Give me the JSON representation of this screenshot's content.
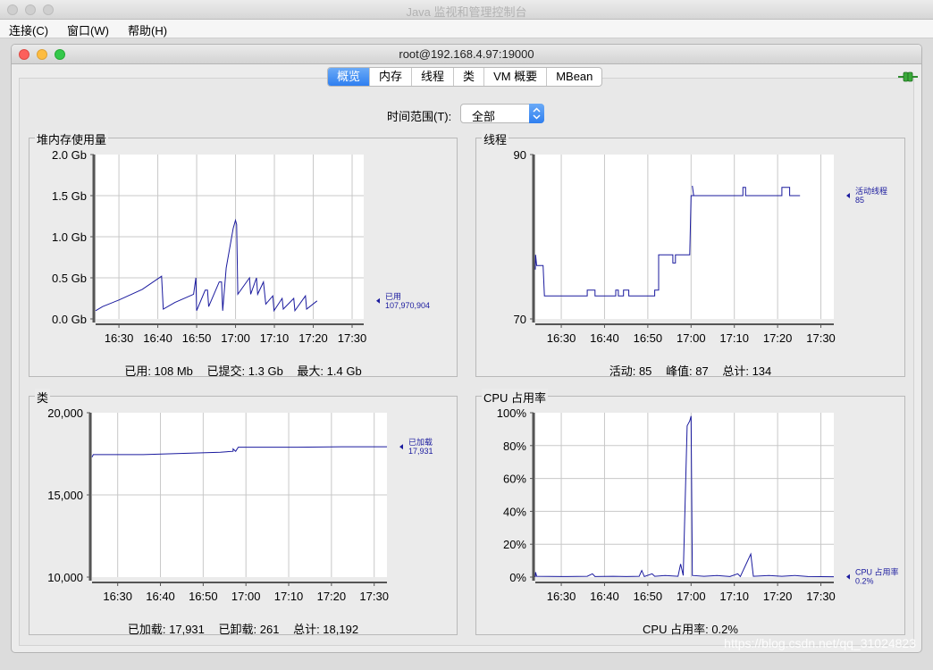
{
  "app": {
    "title": "Java 监视和管理控制台"
  },
  "menu": {
    "items": [
      "连接(C)",
      "窗口(W)",
      "帮助(H)"
    ]
  },
  "window": {
    "title": "root@192.168.4.97:19000"
  },
  "tabs": [
    "概览",
    "内存",
    "线程",
    "类",
    "VM 概要",
    "MBean"
  ],
  "time_range": {
    "label": "时间范围(T):",
    "value": "全部"
  },
  "panels": {
    "heap": {
      "title": "堆内存使用量",
      "footer": [
        "已用: 108 Mb",
        "已提交: 1.3 Gb",
        "最大: 1.4 Gb"
      ]
    },
    "threads": {
      "title": "线程",
      "footer": [
        "活动: 85",
        "峰值: 87",
        "总计: 134"
      ]
    },
    "classes": {
      "title": "类",
      "footer": [
        "已加载: 17,931",
        "已卸载: 261",
        "总计: 18,192"
      ]
    },
    "cpu": {
      "title": "CPU 占用率",
      "footer": [
        "CPU 占用率: 0.2%"
      ]
    }
  },
  "colors": {
    "line": "#1a1a9e",
    "grid": "#c8c8c8",
    "accent": "#2f7ff0"
  },
  "icons": {
    "connection": "connection-plug-icon"
  },
  "watermark": "https://blog.csdn.net/qq_31024823",
  "chart_data": [
    {
      "id": "heap",
      "type": "line",
      "x_ticks": [
        "16:30",
        "16:40",
        "16:50",
        "17:00",
        "17:10",
        "17:20",
        "17:30"
      ],
      "y_ticks": [
        "0.0 Gb",
        "0.5 Gb",
        "1.0 Gb",
        "1.5 Gb",
        "2.0 Gb"
      ],
      "ylim": [
        0,
        2.0
      ],
      "xlim": [
        16.4,
        17.55
      ],
      "tick_start": 16.5,
      "tick_step": 0.1667,
      "legend": [
        "已用",
        "107,970,904"
      ],
      "series": [
        {
          "name": "已用",
          "points": [
            [
              16.4,
              0.1
            ],
            [
              16.43,
              0.15
            ],
            [
              16.5,
              0.23
            ],
            [
              16.6,
              0.36
            ],
            [
              16.683,
              0.52
            ],
            [
              16.69,
              0.12
            ],
            [
              16.74,
              0.2
            ],
            [
              16.82,
              0.3
            ],
            [
              16.83,
              0.5
            ],
            [
              16.833,
              0.1
            ],
            [
              16.87,
              0.35
            ],
            [
              16.88,
              0.35
            ],
            [
              16.885,
              0.15
            ],
            [
              16.93,
              0.45
            ],
            [
              16.94,
              0.45
            ],
            [
              16.945,
              0.1
            ],
            [
              16.96,
              0.62
            ],
            [
              16.99,
              1.1
            ],
            [
              17.0,
              1.2
            ],
            [
              17.005,
              1.15
            ],
            [
              17.01,
              0.3
            ],
            [
              17.06,
              0.5
            ],
            [
              17.065,
              0.3
            ],
            [
              17.09,
              0.5
            ],
            [
              17.095,
              0.3
            ],
            [
              17.12,
              0.45
            ],
            [
              17.13,
              0.18
            ],
            [
              17.16,
              0.28
            ],
            [
              17.165,
              0.1
            ],
            [
              17.2,
              0.25
            ],
            [
              17.205,
              0.12
            ],
            [
              17.25,
              0.25
            ],
            [
              17.255,
              0.1
            ],
            [
              17.3,
              0.28
            ],
            [
              17.305,
              0.12
            ],
            [
              17.35,
              0.22
            ]
          ]
        }
      ]
    },
    {
      "id": "threads",
      "type": "line",
      "x_ticks": [
        "16:30",
        "16:40",
        "16:50",
        "17:00",
        "17:10",
        "17:20",
        "17:30"
      ],
      "y_ticks": [
        "70",
        "90"
      ],
      "ylim": [
        70,
        90
      ],
      "xlim": [
        16.4,
        17.55
      ],
      "tick_start": 16.5,
      "tick_step": 0.1667,
      "legend": [
        "活动线程",
        "85"
      ],
      "series": [
        {
          "name": "活动线程",
          "points": [
            [
              16.4,
              76
            ],
            [
              16.401,
              77.8
            ],
            [
              16.405,
              76.5
            ],
            [
              16.43,
              76.5
            ],
            [
              16.435,
              72.8
            ],
            [
              16.6,
              72.8
            ],
            [
              16.6,
              73.5
            ],
            [
              16.63,
              73.5
            ],
            [
              16.63,
              72.8
            ],
            [
              16.71,
              72.8
            ],
            [
              16.71,
              73.5
            ],
            [
              16.72,
              73.5
            ],
            [
              16.72,
              72.8
            ],
            [
              16.74,
              72.8
            ],
            [
              16.74,
              73.5
            ],
            [
              16.76,
              73.5
            ],
            [
              16.76,
              72.8
            ],
            [
              16.86,
              72.8
            ],
            [
              16.86,
              73.5
            ],
            [
              16.875,
              73.5
            ],
            [
              16.875,
              77.8
            ],
            [
              16.93,
              77.8
            ],
            [
              16.93,
              76.8
            ],
            [
              16.94,
              76.8
            ],
            [
              16.94,
              77.8
            ],
            [
              16.995,
              77.8
            ],
            [
              17.0,
              85
            ],
            [
              17.01,
              85
            ],
            [
              17.005,
              86.2
            ],
            [
              17.01,
              85
            ],
            [
              17.2,
              85
            ],
            [
              17.2,
              86
            ],
            [
              17.21,
              86
            ],
            [
              17.21,
              85
            ],
            [
              17.35,
              85
            ],
            [
              17.35,
              86
            ],
            [
              17.38,
              86
            ],
            [
              17.38,
              85
            ],
            [
              17.42,
              85
            ]
          ]
        }
      ]
    },
    {
      "id": "classes",
      "type": "line",
      "x_ticks": [
        "16:30",
        "16:40",
        "16:50",
        "17:00",
        "17:10",
        "17:20",
        "17:30"
      ],
      "y_ticks": [
        "10,000",
        "15,000",
        "20,000"
      ],
      "ylim": [
        10000,
        20000
      ],
      "xlim": [
        16.4,
        17.55
      ],
      "tick_start": 16.5,
      "tick_step": 0.1667,
      "legend": [
        "已加载",
        "17,931"
      ],
      "series": [
        {
          "name": "已加载",
          "points": [
            [
              16.4,
              17300
            ],
            [
              16.405,
              17450
            ],
            [
              16.6,
              17450
            ],
            [
              16.7,
              17500
            ],
            [
              16.8,
              17550
            ],
            [
              16.9,
              17600
            ],
            [
              16.95,
              17650
            ],
            [
              16.95,
              17800
            ],
            [
              16.96,
              17650
            ],
            [
              16.97,
              17900
            ],
            [
              17.2,
              17900
            ],
            [
              17.4,
              17931
            ],
            [
              17.55,
              17931
            ]
          ]
        }
      ]
    },
    {
      "id": "cpu",
      "type": "line",
      "x_ticks": [
        "16:30",
        "16:40",
        "16:50",
        "17:00",
        "17:10",
        "17:20",
        "17:30"
      ],
      "y_ticks": [
        "0%",
        "20%",
        "40%",
        "60%",
        "80%",
        "100%"
      ],
      "ylim": [
        0,
        100
      ],
      "xlim": [
        16.4,
        17.55
      ],
      "tick_start": 16.5,
      "tick_step": 0.1667,
      "legend": [
        "CPU 占用率",
        "0.2%"
      ],
      "series": [
        {
          "name": "CPU 占用率",
          "points": [
            [
              16.4,
              0
            ],
            [
              16.401,
              3
            ],
            [
              16.405,
              0.5
            ],
            [
              16.5,
              0.3
            ],
            [
              16.6,
              0.5
            ],
            [
              16.62,
              2
            ],
            [
              16.63,
              0.3
            ],
            [
              16.7,
              0.5
            ],
            [
              16.75,
              0.3
            ],
            [
              16.8,
              0.5
            ],
            [
              16.81,
              4
            ],
            [
              16.82,
              0.3
            ],
            [
              16.85,
              2
            ],
            [
              16.86,
              0.5
            ],
            [
              16.9,
              1
            ],
            [
              16.95,
              0.5
            ],
            [
              16.96,
              8
            ],
            [
              16.97,
              1
            ],
            [
              16.985,
              92
            ],
            [
              16.995,
              95
            ],
            [
              17.0,
              98
            ],
            [
              17.005,
              1
            ],
            [
              17.05,
              0.5
            ],
            [
              17.1,
              1
            ],
            [
              17.15,
              0.3
            ],
            [
              17.18,
              2
            ],
            [
              17.19,
              0.3
            ],
            [
              17.23,
              14
            ],
            [
              17.24,
              0.5
            ],
            [
              17.3,
              1
            ],
            [
              17.35,
              0.5
            ],
            [
              17.4,
              1
            ],
            [
              17.45,
              0.3
            ],
            [
              17.55,
              0.2
            ]
          ]
        }
      ]
    }
  ]
}
